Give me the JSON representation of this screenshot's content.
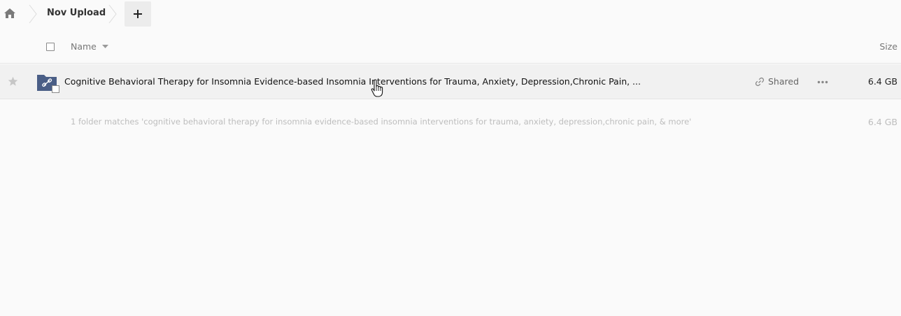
{
  "breadcrumb": {
    "current": "Nov Upload",
    "add_label": "+"
  },
  "header": {
    "name_label": "Name",
    "size_label": "Size"
  },
  "files": [
    {
      "name": "Cognitive Behavioral Therapy for Insomnia Evidence-based Insomnia Interventions for Trauma, Anxiety, Depression,Chronic Pain, ...",
      "shared_label": "Shared",
      "size": "6.4 GB",
      "type_icon": "shared-folder-icon"
    }
  ],
  "summary": {
    "text": "1 folder matches 'cognitive behavioral therapy for insomnia evidence-based insomnia interventions for trauma, anxiety, depression,chronic pain, & more'",
    "size": "6.4 GB"
  },
  "colors": {
    "folder": "#4a5e86",
    "background": "#fafafa",
    "row_highlight": "#f1f1f1"
  }
}
